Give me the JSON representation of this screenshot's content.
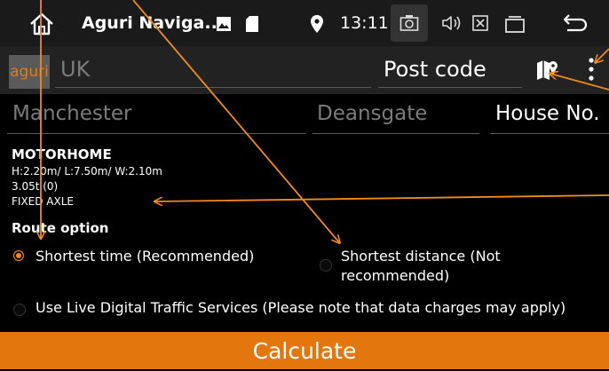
{
  "status_bar": {
    "app_title": "Aguri Naviga...",
    "time": "13:11"
  },
  "search": {
    "logo_text": "aguri",
    "country": "UK",
    "postcode_placeholder": "Post code",
    "city_placeholder": "Manchester",
    "street_placeholder": "Deansgate",
    "house_no_placeholder": "House No."
  },
  "vehicle": {
    "name": "MOTORHOME",
    "dimensions": "H:2.20m/ L:7.50m/ W:2.10m",
    "weight": "3.05t (0)",
    "axle": "FIXED AXLE"
  },
  "route": {
    "heading": "Route option",
    "shortest_time": "Shortest time (Recommended)",
    "shortest_distance_l1": "Shortest distance (Not",
    "shortest_distance_l2": "recommended)",
    "traffic": "Use Live Digital Traffic Services (Please note that data charges may apply)",
    "selected": "shortest_time"
  },
  "calculate_label": "Calculate",
  "colors": {
    "accent": "#e3770d",
    "annotation_arrow": "#f08a1a"
  }
}
